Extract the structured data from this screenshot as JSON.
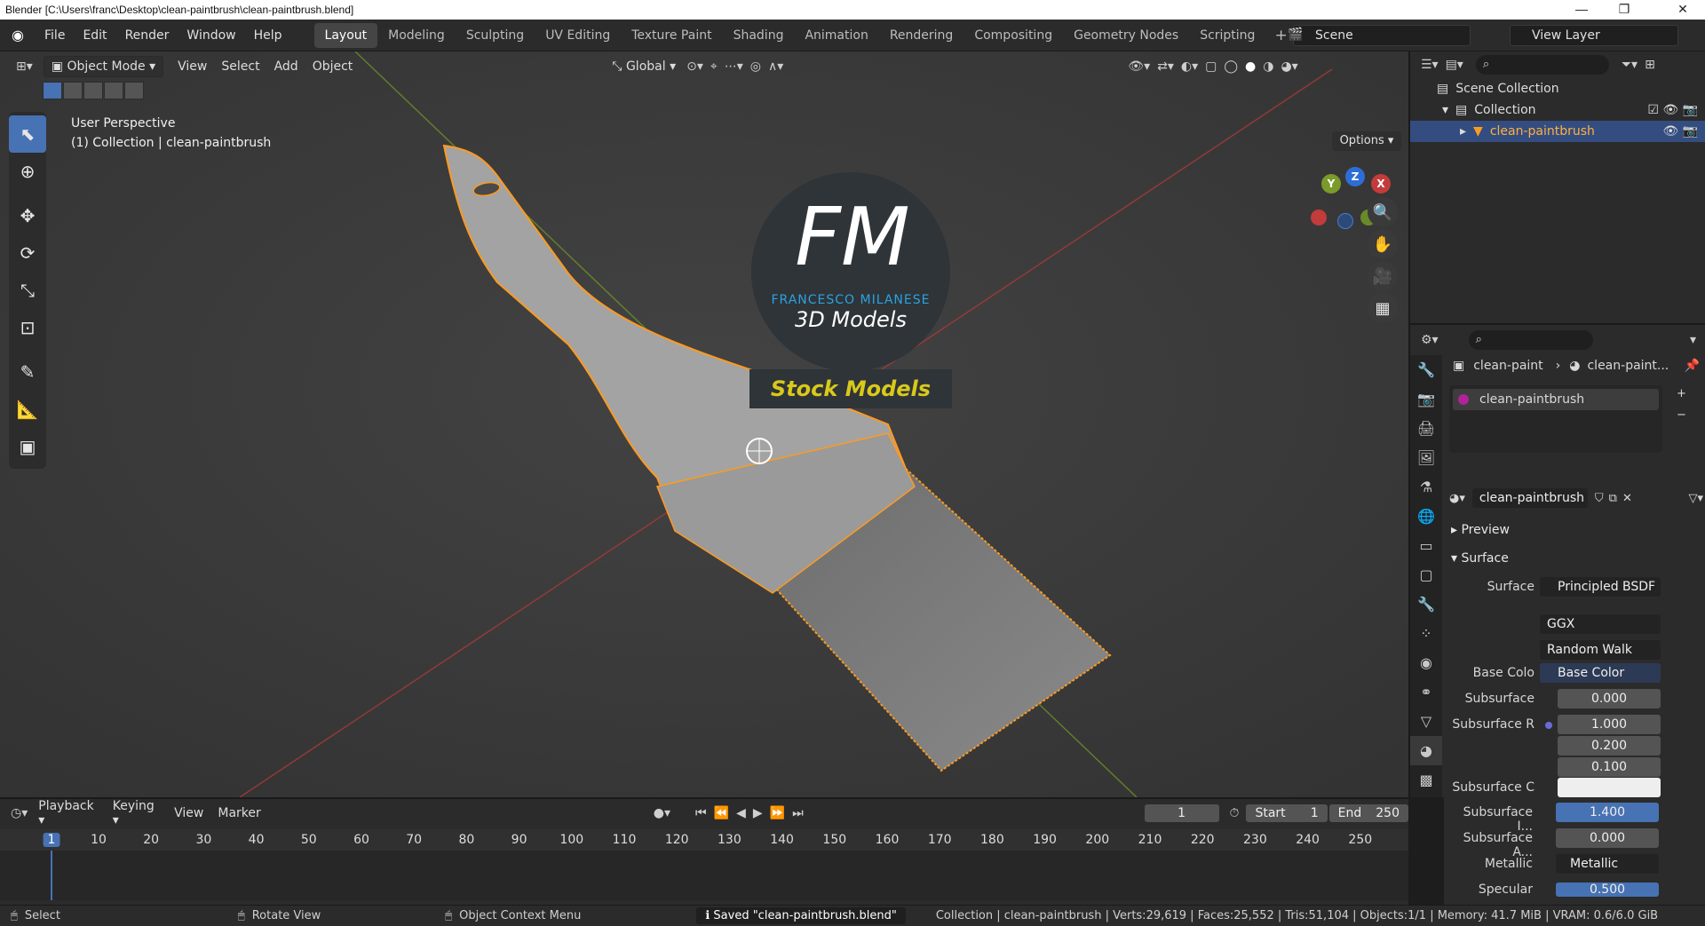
{
  "window": {
    "title": "Blender [C:\\Users\\franc\\Desktop\\clean-paintbrush\\clean-paintbrush.blend]",
    "controls": [
      "—",
      "❐",
      "✕"
    ]
  },
  "menu": [
    "File",
    "Edit",
    "Render",
    "Window",
    "Help"
  ],
  "workspaces": [
    "Layout",
    "Modeling",
    "Sculpting",
    "UV Editing",
    "Texture Paint",
    "Shading",
    "Animation",
    "Rendering",
    "Compositing",
    "Geometry Nodes",
    "Scripting"
  ],
  "workspace_add": "+",
  "scene": {
    "label": "Scene",
    "view_layer": "View Layer"
  },
  "viewport": {
    "mode": "Object Mode",
    "menus": [
      "View",
      "Select",
      "Add",
      "Object"
    ],
    "orientation": "Global",
    "info_line1": "User Perspective",
    "info_line2": "(1) Collection | clean-paintbrush",
    "options": "Options",
    "gizmo": {
      "y": "Y",
      "z": "Z",
      "x": "X"
    },
    "logo": {
      "letters": "FM",
      "name": "FRANCESCO MILANESE",
      "sub": "3D Models",
      "banner": "Stock Models"
    }
  },
  "outliner": {
    "scene_collection": "Scene Collection",
    "collection": "Collection",
    "object": "clean-paintbrush"
  },
  "properties": {
    "breadcrumb_obj": "clean-paint",
    "breadcrumb_mat": "clean-paint...",
    "material_slot": "clean-paintbrush",
    "material_name": "clean-paintbrush",
    "preview": "Preview",
    "surface_section": "Surface",
    "surface_label": "Surface",
    "surface_value": "Principled BSDF",
    "distribution": "GGX",
    "subsurface_method": "Random Walk",
    "base_color_label": "Base Colo",
    "base_color_value": "Base Color",
    "subsurface_label": "Subsurface",
    "subsurface_value": "0.000",
    "subsurface_r_label": "Subsurface R",
    "subsurface_r": [
      "1.000",
      "0.200",
      "0.100"
    ],
    "subsurface_c_label": "Subsurface C",
    "subsurface_ior_label": "Subsurface I...",
    "subsurface_ior": "1.400",
    "subsurface_a_label": "Subsurface A...",
    "subsurface_a": "0.000",
    "metallic_label": "Metallic",
    "metallic_value": "Metallic",
    "specular_label": "Specular",
    "specular_value": "0.500"
  },
  "timeline": {
    "menus": [
      "Playback",
      "Keying",
      "View",
      "Marker"
    ],
    "current_frame": "1",
    "start_label": "Start",
    "start": "1",
    "end_label": "End",
    "end": "250",
    "ticks": [
      "1",
      "10",
      "20",
      "30",
      "40",
      "50",
      "60",
      "70",
      "80",
      "90",
      "100",
      "110",
      "120",
      "130",
      "140",
      "150",
      "160",
      "170",
      "180",
      "190",
      "200",
      "210",
      "220",
      "230",
      "240",
      "250"
    ]
  },
  "status": {
    "select": "Select",
    "rotate": "Rotate View",
    "context": "Object Context Menu",
    "saved": "Saved \"clean-paintbrush.blend\"",
    "stats": "Collection | clean-paintbrush | Verts:29,619 | Faces:25,552 | Tris:51,104 | Objects:1/1 | Memory: 41.7 MiB | VRAM: 0.6/6.0 GiB"
  },
  "colors": {
    "accent": "#4772b3",
    "selected_orange": "#ff9a1f",
    "logo_blue": "#2aa3df",
    "banner_yellow": "#d9c91a"
  }
}
